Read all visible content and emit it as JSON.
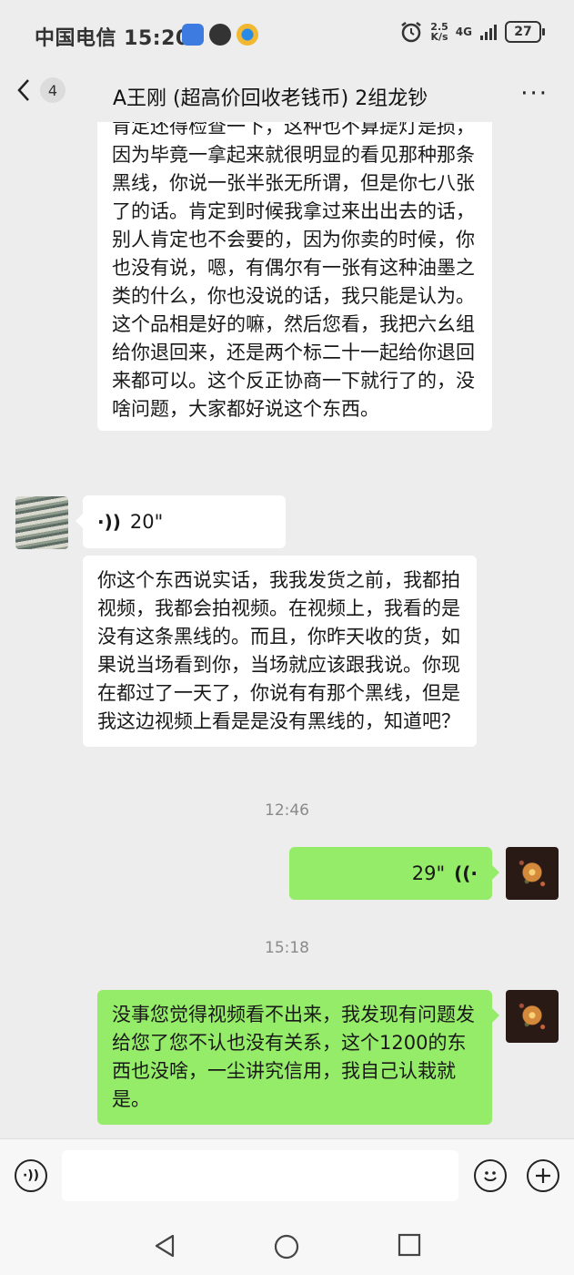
{
  "status_bar": {
    "carrier_time": "中国电信 15:20",
    "net_speed_value": "2.5",
    "net_speed_unit": "K/s",
    "network": "4G",
    "battery": "27",
    "icons": [
      "alarm-icon",
      "signal-icon"
    ]
  },
  "nav": {
    "unread_count": "4",
    "title": "A王刚 (超高价回收老钱币) 2组龙钞",
    "more": "···"
  },
  "messages": [
    {
      "side": "left",
      "type": "text",
      "text": "肯定还得检查一下，这种也不算提灯是损，因为毕竟一拿起来就很明显的看见那种那条黑线，你说一张半张无所谓，但是你七八张了的话。肯定到时候我拿过来出出去的话，别人肯定也不会要的，因为你卖的时候，你也没有说，嗯，有偶尔有一张有这种油墨之类的什么，你也没说的话，我只能是认为。这个品相是好的嘛，然后您看，我把六幺组给你退回来，还是两个标二十一起给你退回来都可以。这个反正协商一下就行了的，没啥问题，大家都好说这个东西。"
    },
    {
      "side": "left",
      "type": "voice",
      "duration": "20\""
    },
    {
      "side": "left",
      "type": "text",
      "text": "你这个东西说实话，我我发货之前，我都拍视频，我都会拍视频。在视频上，我看的是没有这条黑线的。而且，你昨天收的货，如果说当场看到你，当场就应该跟我说。你现在都过了一天了，你说有有那个黑线，但是我这边视频上看是是没有黑线的，知道吧？"
    },
    {
      "type": "time",
      "text": "12:46"
    },
    {
      "side": "right",
      "type": "voice",
      "duration": "29\""
    },
    {
      "type": "time",
      "text": "15:18"
    },
    {
      "side": "right",
      "type": "text",
      "text": "没事您觉得视频看不出来，我发现有问题发给您了您不认也没有关系，这个1200的东西也没啥，一尘讲究信用，我自己认栽就是。"
    }
  ],
  "system_nav": [
    "back-triangle-icon",
    "home-circle-icon",
    "recents-square-icon"
  ],
  "colors": {
    "background": "#ededed",
    "bubble_self": "#95ec69",
    "bubble_other": "#ffffff"
  }
}
